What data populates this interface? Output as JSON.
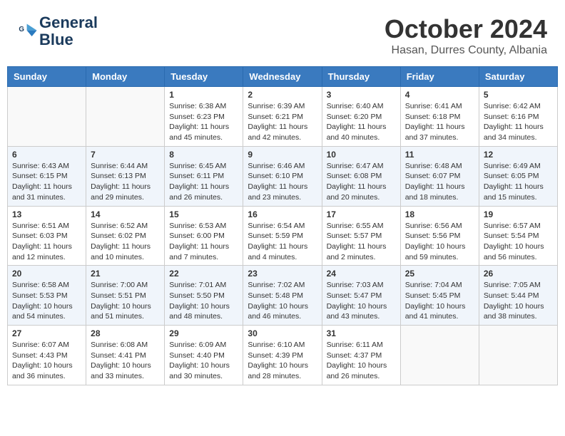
{
  "header": {
    "logo_line1": "General",
    "logo_line2": "Blue",
    "month_title": "October 2024",
    "location": "Hasan, Durres County, Albania"
  },
  "days_of_week": [
    "Sunday",
    "Monday",
    "Tuesday",
    "Wednesday",
    "Thursday",
    "Friday",
    "Saturday"
  ],
  "weeks": [
    [
      {
        "day": "",
        "sunrise": "",
        "sunset": "",
        "daylight": ""
      },
      {
        "day": "",
        "sunrise": "",
        "sunset": "",
        "daylight": ""
      },
      {
        "day": "1",
        "sunrise": "Sunrise: 6:38 AM",
        "sunset": "Sunset: 6:23 PM",
        "daylight": "Daylight: 11 hours and 45 minutes."
      },
      {
        "day": "2",
        "sunrise": "Sunrise: 6:39 AM",
        "sunset": "Sunset: 6:21 PM",
        "daylight": "Daylight: 11 hours and 42 minutes."
      },
      {
        "day": "3",
        "sunrise": "Sunrise: 6:40 AM",
        "sunset": "Sunset: 6:20 PM",
        "daylight": "Daylight: 11 hours and 40 minutes."
      },
      {
        "day": "4",
        "sunrise": "Sunrise: 6:41 AM",
        "sunset": "Sunset: 6:18 PM",
        "daylight": "Daylight: 11 hours and 37 minutes."
      },
      {
        "day": "5",
        "sunrise": "Sunrise: 6:42 AM",
        "sunset": "Sunset: 6:16 PM",
        "daylight": "Daylight: 11 hours and 34 minutes."
      }
    ],
    [
      {
        "day": "6",
        "sunrise": "Sunrise: 6:43 AM",
        "sunset": "Sunset: 6:15 PM",
        "daylight": "Daylight: 11 hours and 31 minutes."
      },
      {
        "day": "7",
        "sunrise": "Sunrise: 6:44 AM",
        "sunset": "Sunset: 6:13 PM",
        "daylight": "Daylight: 11 hours and 29 minutes."
      },
      {
        "day": "8",
        "sunrise": "Sunrise: 6:45 AM",
        "sunset": "Sunset: 6:11 PM",
        "daylight": "Daylight: 11 hours and 26 minutes."
      },
      {
        "day": "9",
        "sunrise": "Sunrise: 6:46 AM",
        "sunset": "Sunset: 6:10 PM",
        "daylight": "Daylight: 11 hours and 23 minutes."
      },
      {
        "day": "10",
        "sunrise": "Sunrise: 6:47 AM",
        "sunset": "Sunset: 6:08 PM",
        "daylight": "Daylight: 11 hours and 20 minutes."
      },
      {
        "day": "11",
        "sunrise": "Sunrise: 6:48 AM",
        "sunset": "Sunset: 6:07 PM",
        "daylight": "Daylight: 11 hours and 18 minutes."
      },
      {
        "day": "12",
        "sunrise": "Sunrise: 6:49 AM",
        "sunset": "Sunset: 6:05 PM",
        "daylight": "Daylight: 11 hours and 15 minutes."
      }
    ],
    [
      {
        "day": "13",
        "sunrise": "Sunrise: 6:51 AM",
        "sunset": "Sunset: 6:03 PM",
        "daylight": "Daylight: 11 hours and 12 minutes."
      },
      {
        "day": "14",
        "sunrise": "Sunrise: 6:52 AM",
        "sunset": "Sunset: 6:02 PM",
        "daylight": "Daylight: 11 hours and 10 minutes."
      },
      {
        "day": "15",
        "sunrise": "Sunrise: 6:53 AM",
        "sunset": "Sunset: 6:00 PM",
        "daylight": "Daylight: 11 hours and 7 minutes."
      },
      {
        "day": "16",
        "sunrise": "Sunrise: 6:54 AM",
        "sunset": "Sunset: 5:59 PM",
        "daylight": "Daylight: 11 hours and 4 minutes."
      },
      {
        "day": "17",
        "sunrise": "Sunrise: 6:55 AM",
        "sunset": "Sunset: 5:57 PM",
        "daylight": "Daylight: 11 hours and 2 minutes."
      },
      {
        "day": "18",
        "sunrise": "Sunrise: 6:56 AM",
        "sunset": "Sunset: 5:56 PM",
        "daylight": "Daylight: 10 hours and 59 minutes."
      },
      {
        "day": "19",
        "sunrise": "Sunrise: 6:57 AM",
        "sunset": "Sunset: 5:54 PM",
        "daylight": "Daylight: 10 hours and 56 minutes."
      }
    ],
    [
      {
        "day": "20",
        "sunrise": "Sunrise: 6:58 AM",
        "sunset": "Sunset: 5:53 PM",
        "daylight": "Daylight: 10 hours and 54 minutes."
      },
      {
        "day": "21",
        "sunrise": "Sunrise: 7:00 AM",
        "sunset": "Sunset: 5:51 PM",
        "daylight": "Daylight: 10 hours and 51 minutes."
      },
      {
        "day": "22",
        "sunrise": "Sunrise: 7:01 AM",
        "sunset": "Sunset: 5:50 PM",
        "daylight": "Daylight: 10 hours and 48 minutes."
      },
      {
        "day": "23",
        "sunrise": "Sunrise: 7:02 AM",
        "sunset": "Sunset: 5:48 PM",
        "daylight": "Daylight: 10 hours and 46 minutes."
      },
      {
        "day": "24",
        "sunrise": "Sunrise: 7:03 AM",
        "sunset": "Sunset: 5:47 PM",
        "daylight": "Daylight: 10 hours and 43 minutes."
      },
      {
        "day": "25",
        "sunrise": "Sunrise: 7:04 AM",
        "sunset": "Sunset: 5:45 PM",
        "daylight": "Daylight: 10 hours and 41 minutes."
      },
      {
        "day": "26",
        "sunrise": "Sunrise: 7:05 AM",
        "sunset": "Sunset: 5:44 PM",
        "daylight": "Daylight: 10 hours and 38 minutes."
      }
    ],
    [
      {
        "day": "27",
        "sunrise": "Sunrise: 6:07 AM",
        "sunset": "Sunset: 4:43 PM",
        "daylight": "Daylight: 10 hours and 36 minutes."
      },
      {
        "day": "28",
        "sunrise": "Sunrise: 6:08 AM",
        "sunset": "Sunset: 4:41 PM",
        "daylight": "Daylight: 10 hours and 33 minutes."
      },
      {
        "day": "29",
        "sunrise": "Sunrise: 6:09 AM",
        "sunset": "Sunset: 4:40 PM",
        "daylight": "Daylight: 10 hours and 30 minutes."
      },
      {
        "day": "30",
        "sunrise": "Sunrise: 6:10 AM",
        "sunset": "Sunset: 4:39 PM",
        "daylight": "Daylight: 10 hours and 28 minutes."
      },
      {
        "day": "31",
        "sunrise": "Sunrise: 6:11 AM",
        "sunset": "Sunset: 4:37 PM",
        "daylight": "Daylight: 10 hours and 26 minutes."
      },
      {
        "day": "",
        "sunrise": "",
        "sunset": "",
        "daylight": ""
      },
      {
        "day": "",
        "sunrise": "",
        "sunset": "",
        "daylight": ""
      }
    ]
  ]
}
